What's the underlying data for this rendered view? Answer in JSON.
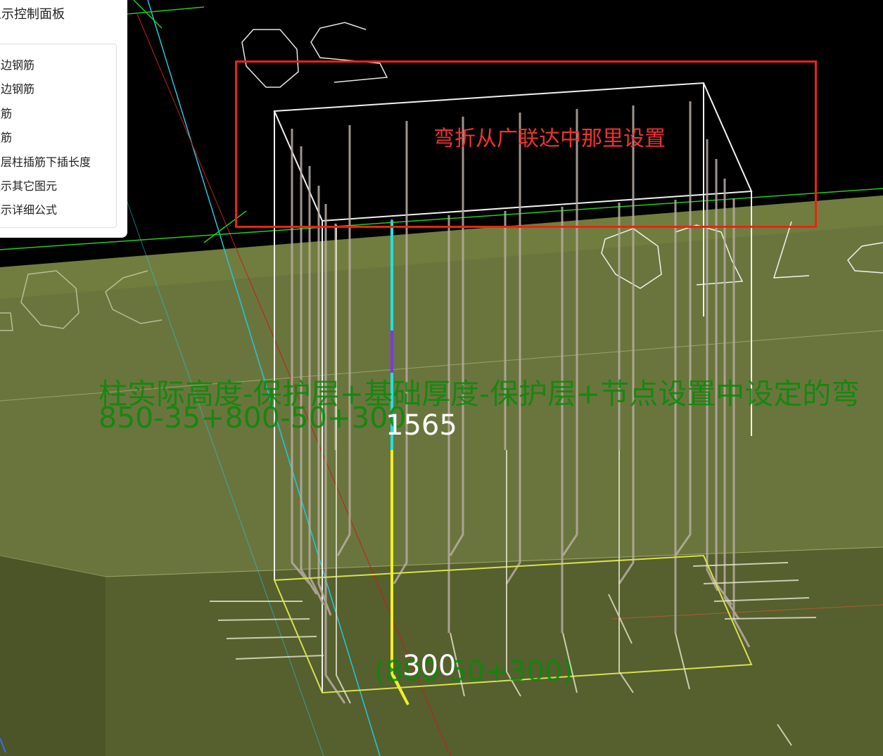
{
  "control_panel": {
    "title": "显示控制面板",
    "items": [
      "底边钢筋",
      "侧边钢筋",
      "插筋",
      "箍筋",
      "上层柱插筋下插长度",
      "显示其它图元",
      "显示详细公式"
    ]
  },
  "annotations": {
    "bend_note": "弯折从广联达中那里设置",
    "formula_desc": "柱实际高度-保护层+基础厚度-保护层+节点设置中设定的弯",
    "formula_values": "850-35+800-50+300",
    "bend_formula": "(800-50+300)"
  },
  "dimensions": {
    "total_length": "1565",
    "bend_length": "300"
  },
  "colors": {
    "background": "#000000",
    "foundation": "#5e6a34",
    "highlight_box": "#e22222",
    "annotation_green": "#0a8a0a",
    "rebar_selected_cyan": "#22e0e0",
    "rebar_selected_yellow": "#f0f020",
    "axis_green": "#22cc22"
  }
}
